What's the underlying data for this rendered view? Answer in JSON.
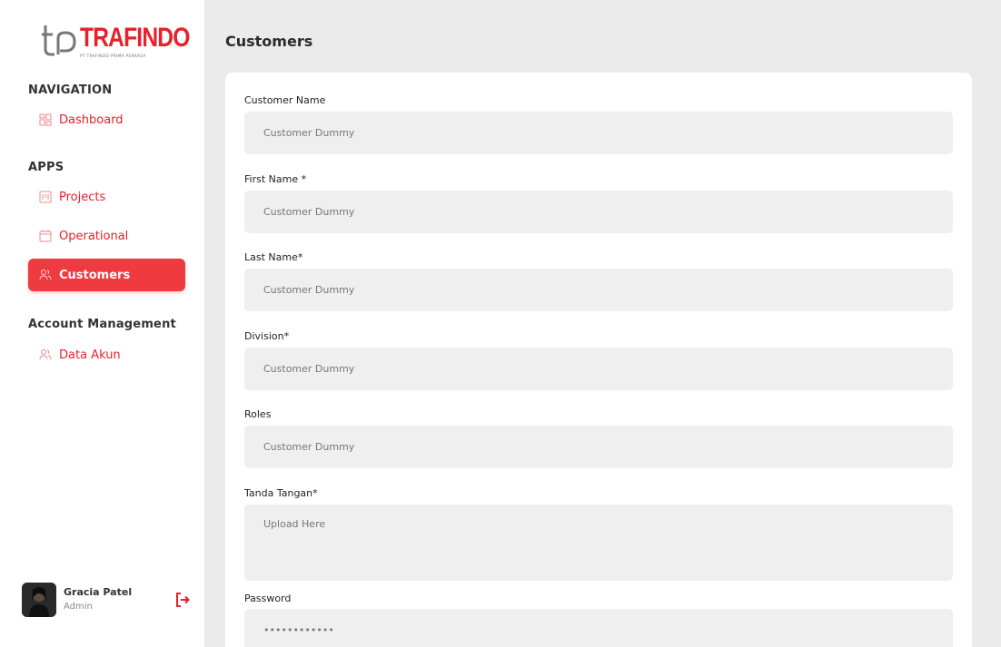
{
  "app": {
    "brand_name": "TRAFINDO",
    "brand_sub": "PT TRAFINDO PRIMA PERKASA",
    "accent_color": "#e8202a"
  },
  "sidebar": {
    "navigation_title": "NAVIGATION",
    "dashboard_label": "Dashboard",
    "apps_title": "APPS",
    "projects_label": "Projects",
    "operational_label": "Operational",
    "customers_label": "Customers",
    "account_title": "Account Management",
    "data_akun_label": "Data Akun",
    "icons": [
      "dashboard-icon",
      "projects-icon",
      "calendar-icon",
      "users-icon",
      "user-icon"
    ]
  },
  "user": {
    "name": "Gracia Patel",
    "role": "Admin",
    "logout_icon": "logout-icon"
  },
  "page": {
    "title": "Customers"
  },
  "form": {
    "customer_name": {
      "label": "Customer Name",
      "value": "Customer Dummy"
    },
    "first_name": {
      "label": "First Name *",
      "value": "Customer Dummy"
    },
    "last_name": {
      "label": "Last Name*",
      "value": "Customer Dummy"
    },
    "division": {
      "label": "Division*",
      "value": "Customer Dummy"
    },
    "roles": {
      "label": "Roles",
      "value": "Customer Dummy"
    },
    "signature": {
      "label": "Tanda Tangan*",
      "placeholder": "Upload Here"
    },
    "password": {
      "label": "Password",
      "value": "••••••••••••"
    }
  }
}
